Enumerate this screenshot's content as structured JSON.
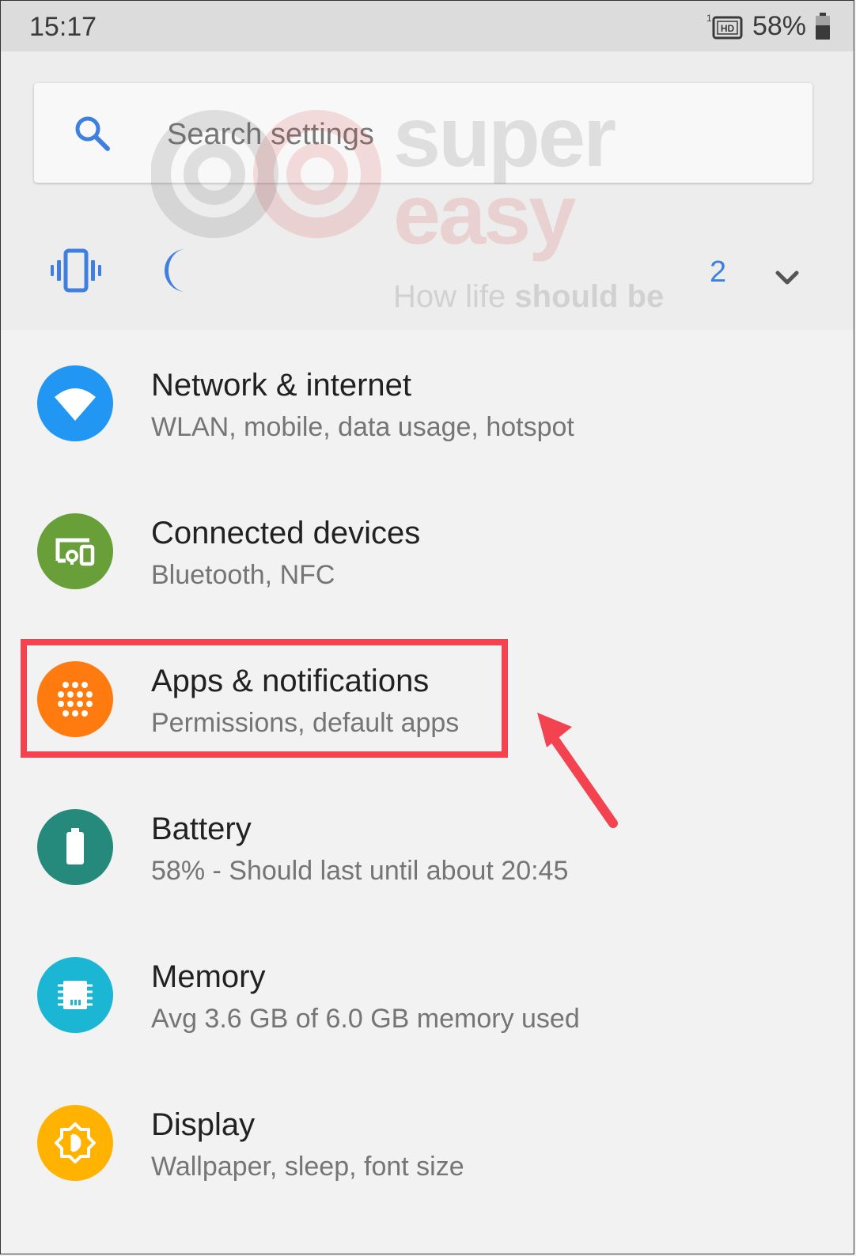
{
  "status_bar": {
    "time": "15:17",
    "sim_slot": "1",
    "network_badge": "HD",
    "battery_percent": "58%"
  },
  "search": {
    "placeholder": "Search settings"
  },
  "conditions": {
    "count": "2",
    "icons": [
      "vibrate-icon",
      "do-not-disturb-moon-icon",
      "chevron-down-icon"
    ]
  },
  "watermark": {
    "line1": "super",
    "line2": "easy",
    "tagline_part1": "How life ",
    "tagline_part2": "should be"
  },
  "settings": [
    {
      "title": "Network & internet",
      "subtitle": "WLAN, mobile, data usage, hotspot",
      "icon": "wifi-icon",
      "color": "#2196f3"
    },
    {
      "title": "Connected devices",
      "subtitle": "Bluetooth, NFC",
      "icon": "devices-icon",
      "color": "#689f38"
    },
    {
      "title": "Apps & notifications",
      "subtitle": "Permissions, default apps",
      "icon": "apps-grid-icon",
      "color": "#ff7b10"
    },
    {
      "title": "Battery",
      "subtitle": "58% - Should last until about 20:45",
      "icon": "battery-icon",
      "color": "#258a7c"
    },
    {
      "title": "Memory",
      "subtitle": "Avg 3.6 GB of 6.0 GB memory used",
      "icon": "memory-chip-icon",
      "color": "#1ab6d4"
    },
    {
      "title": "Display",
      "subtitle": "Wallpaper, sleep, font size",
      "icon": "brightness-icon",
      "color": "#ffb300"
    }
  ],
  "annotation": {
    "highlight_color": "#f44350"
  }
}
